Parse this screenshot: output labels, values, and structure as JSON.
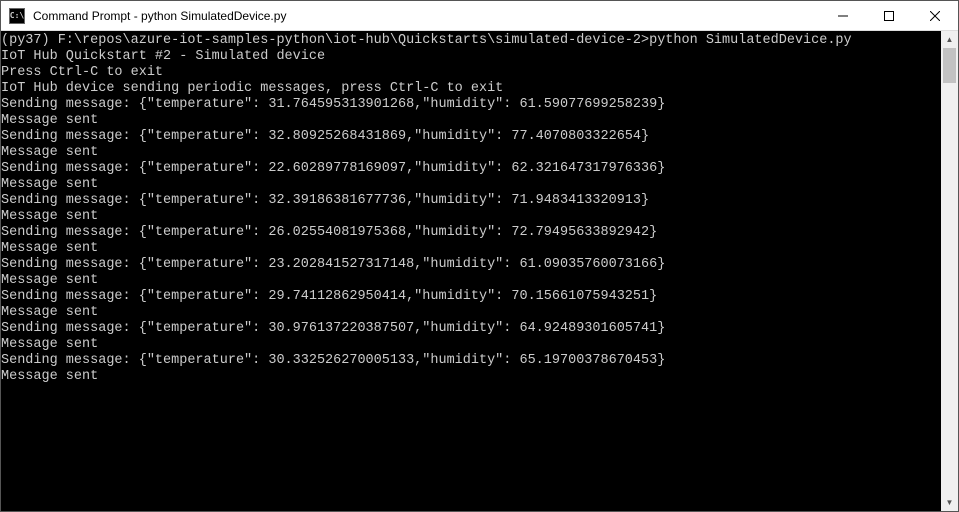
{
  "window": {
    "title": "Command Prompt - python  SimulatedDevice.py",
    "icon_label": "C:\\"
  },
  "terminal": {
    "prompt_line": "(py37) F:\\repos\\azure-iot-samples-python\\iot-hub\\Quickstarts\\simulated-device-2>python SimulatedDevice.py",
    "header1": "IoT Hub Quickstart #2 - Simulated device",
    "header2": "Press Ctrl-C to exit",
    "header3": "IoT Hub device sending periodic messages, press Ctrl-C to exit",
    "messages": [
      {
        "send": "Sending message: {\"temperature\": 31.764595313901268,\"humidity\": 61.59077699258239}",
        "ack": "Message sent"
      },
      {
        "send": "Sending message: {\"temperature\": 32.80925268431869,\"humidity\": 77.4070803322654}",
        "ack": "Message sent"
      },
      {
        "send": "Sending message: {\"temperature\": 22.60289778169097,\"humidity\": 62.321647317976336}",
        "ack": "Message sent"
      },
      {
        "send": "Sending message: {\"temperature\": 32.39186381677736,\"humidity\": 71.9483413320913}",
        "ack": "Message sent"
      },
      {
        "send": "Sending message: {\"temperature\": 26.02554081975368,\"humidity\": 72.79495633892942}",
        "ack": "Message sent"
      },
      {
        "send": "Sending message: {\"temperature\": 23.202841527317148,\"humidity\": 61.09035760073166}",
        "ack": "Message sent"
      },
      {
        "send": "Sending message: {\"temperature\": 29.74112862950414,\"humidity\": 70.15661075943251}",
        "ack": "Message sent"
      },
      {
        "send": "Sending message: {\"temperature\": 30.976137220387507,\"humidity\": 64.92489301605741}",
        "ack": "Message sent"
      },
      {
        "send": "Sending message: {\"temperature\": 30.332526270005133,\"humidity\": 65.19700378670453}",
        "ack": "Message sent"
      }
    ]
  }
}
